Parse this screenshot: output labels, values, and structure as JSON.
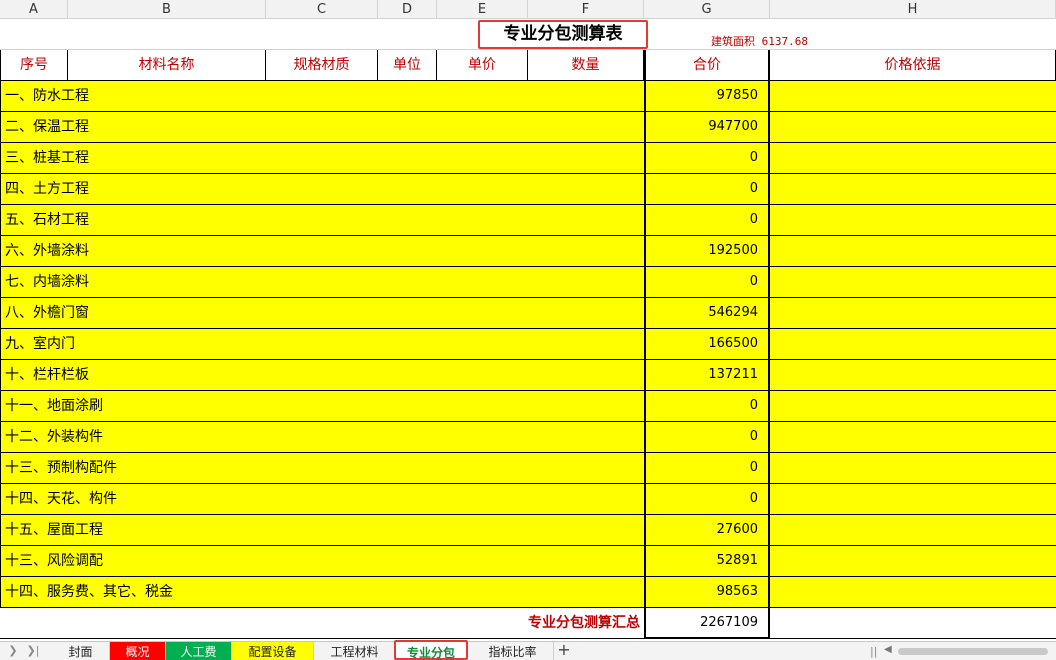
{
  "columns": [
    "A",
    "B",
    "C",
    "D",
    "E",
    "F",
    "G",
    "H"
  ],
  "sheet": {
    "title": "专业分包测算表",
    "area_label": "建筑面积",
    "area_value": "6137.68"
  },
  "headers": {
    "seq": "序号",
    "material": "材料名称",
    "spec": "规格材质",
    "unit": "单位",
    "price": "单价",
    "qty": "数量",
    "total": "合价",
    "basis": "价格依据"
  },
  "rows": [
    {
      "name": "一、防水工程",
      "total": "97850"
    },
    {
      "name": "二、保温工程",
      "total": "947700"
    },
    {
      "name": "三、桩基工程",
      "total": "0"
    },
    {
      "name": "四、土方工程",
      "total": "0"
    },
    {
      "name": "五、石材工程",
      "total": "0"
    },
    {
      "name": "六、外墙涂料",
      "total": "192500"
    },
    {
      "name": "七、内墙涂料",
      "total": "0"
    },
    {
      "name": "八、外檐门窗",
      "total": "546294"
    },
    {
      "name": "九、室内门",
      "total": "166500"
    },
    {
      "name": "十、栏杆栏板",
      "total": "137211"
    },
    {
      "name": "十一、地面涂刷",
      "total": "0"
    },
    {
      "name": "十二、外装构件",
      "total": "0"
    },
    {
      "name": "十三、预制构配件",
      "total": "0"
    },
    {
      "name": "十四、天花、构件",
      "total": "0"
    },
    {
      "name": "十五、屋面工程",
      "total": "27600"
    },
    {
      "name": "十三、风险调配",
      "total": "52891"
    },
    {
      "name": "十四、服务费、其它、税金",
      "total": "98563"
    }
  ],
  "summary": {
    "label": "专业分包测算汇总",
    "value": "2267109"
  },
  "sheet_tabs": [
    {
      "label": "封面",
      "color": "#f3f3f3",
      "text": "#222222"
    },
    {
      "label": "概况",
      "color": "#ff0000",
      "text": "#ffffff"
    },
    {
      "label": "人工费",
      "color": "#00b050",
      "text": "#ffffff"
    },
    {
      "label": "配置设备",
      "color": "#ffff00",
      "text": "#222222"
    },
    {
      "label": "工程材料",
      "color": "#f3f3f3",
      "text": "#222222"
    },
    {
      "label": "专业分包",
      "color": "#ffffff",
      "text": "#0c8b3a",
      "active": true
    },
    {
      "label": "指标比率",
      "color": "#f3f3f3",
      "text": "#222222"
    }
  ],
  "colors": {
    "highlight": "#ffff00",
    "header_text": "#c00000",
    "callout": "#e53935"
  }
}
